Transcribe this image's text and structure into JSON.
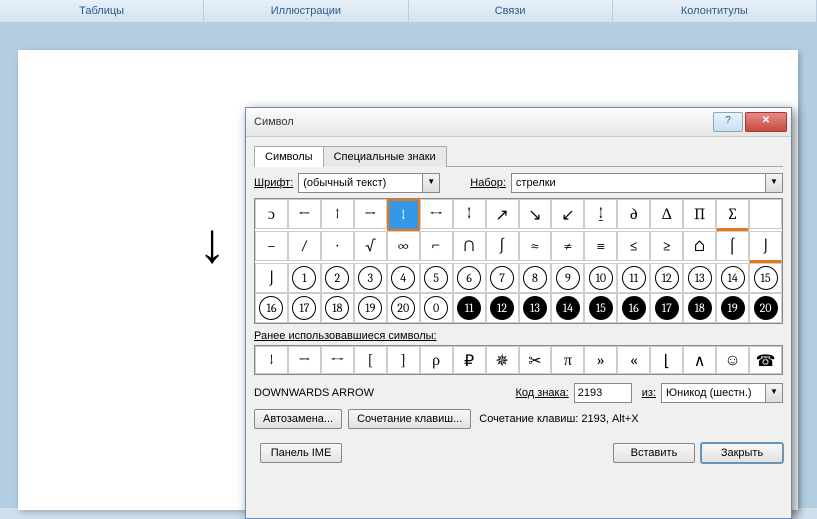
{
  "ribbon": [
    "Таблицы",
    "Иллюстрации",
    "Связи",
    "Колонтитулы"
  ],
  "doc_symbol": "↓",
  "title": "Символ",
  "tabs": [
    "Символы",
    "Специальные знаки"
  ],
  "font_label": "Шрифт:",
  "font_value": "(обычный текст)",
  "set_label": "Набор:",
  "set_value": "стрелки",
  "grid_rows": [
    [
      "ɔ",
      "←",
      "↑",
      "→",
      "↓",
      "↔",
      "↕",
      "↗",
      "↘",
      "↙",
      "↨",
      "∂",
      "Δ",
      "∏",
      "_h1"
    ],
    [
      "−",
      "∕",
      "∙",
      "√",
      "∞",
      "⌐",
      "∩",
      "∫",
      "≈",
      "≠",
      "≡",
      "≤",
      "≥",
      "⌂",
      "⌠",
      "_h2"
    ],
    [
      "⌡",
      "①",
      "②",
      "③",
      "④",
      "⑤",
      "⑥",
      "⑦",
      "⑧",
      "⑨",
      "⑩",
      "⑪",
      "⑫",
      "⑬",
      "⑭",
      "⑮"
    ],
    [
      "⑯",
      "⑰",
      "⑱",
      "⑲",
      "⑳",
      "⓪",
      "⓫",
      "⓬",
      "⓭",
      "⓮",
      "⓯",
      "⓰",
      "⓱",
      "⓲",
      "⓳",
      "⓴"
    ]
  ],
  "row1_special": {
    "15": "⨊"
  },
  "row2_special": {
    "15": "∫"
  },
  "circled_white": [
    "①",
    "②",
    "③",
    "④",
    "⑤",
    "⑥",
    "⑦",
    "⑧",
    "⑨",
    "⑩",
    "⑪",
    "⑫",
    "⑬",
    "⑭",
    "⑮",
    "⑯",
    "⑰",
    "⑱",
    "⑲",
    "⑳",
    "⓪"
  ],
  "circled_black_start": 11,
  "recent_label": "Ранее использовавшиеся символы:",
  "recent": [
    "↓",
    "→",
    "↔",
    "[",
    "]",
    "ρ",
    "₽",
    "✵",
    "✂",
    "π",
    "»",
    "«",
    "⌊",
    "∧",
    "☺",
    "☎"
  ],
  "symbol_name": "DOWNWARDS ARROW",
  "code_label": "Код знака:",
  "code_value": "2193",
  "from_label": "из:",
  "from_value": "Юникод (шестн.)",
  "autocorrect": "Автозамена...",
  "shortcut_btn": "Сочетание клавиш...",
  "shortcut_text": "Сочетание клавиш: 2193, Alt+X",
  "ime": "Панель IME",
  "insert": "Вставить",
  "close": "Закрыть"
}
